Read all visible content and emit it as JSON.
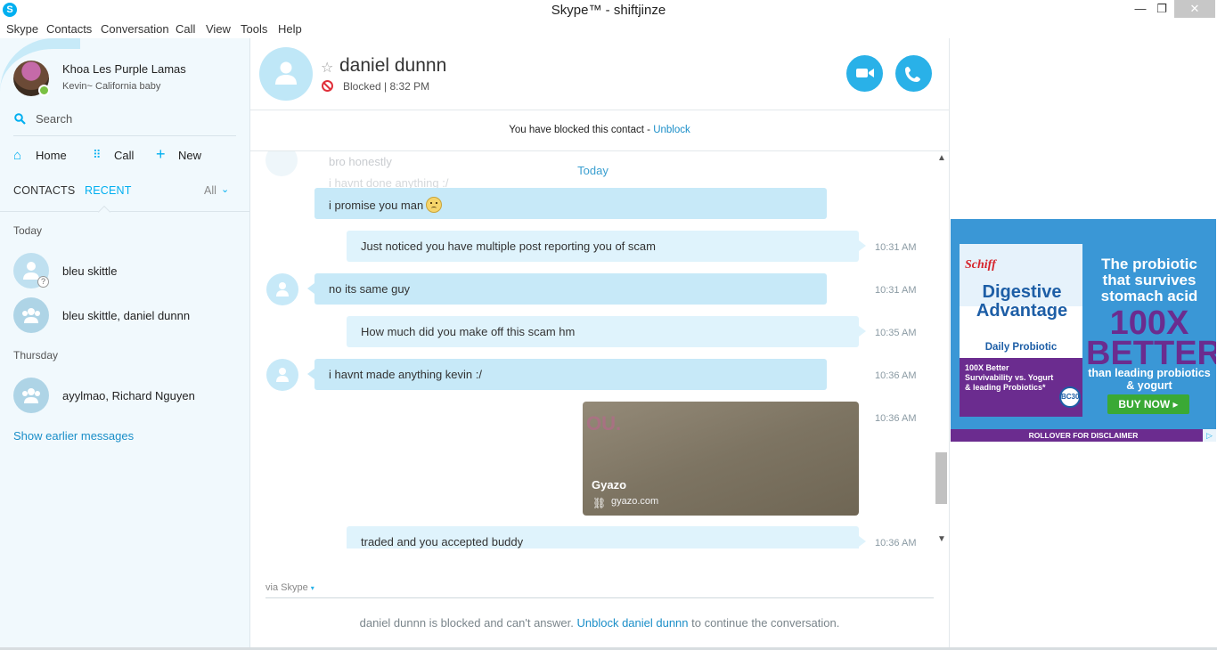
{
  "window": {
    "title": "Skype™ - shiftjinze",
    "logo_glyph": "S",
    "min_glyph": "—",
    "max_glyph": "❐",
    "close_glyph": "✕"
  },
  "menu": [
    "Skype",
    "Contacts",
    "Conversation",
    "Call",
    "View",
    "Tools",
    "Help"
  ],
  "sidebar": {
    "user_name": "Khoa Les Purple Lamas",
    "user_mood": "Kevin~ California baby",
    "search_placeholder": "Search",
    "nav": [
      {
        "label": "Home",
        "icon": "home-icon",
        "glyph": "⌂"
      },
      {
        "label": "Call",
        "icon": "dialpad-icon",
        "glyph": "⠿"
      },
      {
        "label": "New",
        "icon": "plus-icon",
        "glyph": "+"
      }
    ],
    "tabs": {
      "contacts": "CONTACTS",
      "recent": "RECENT",
      "filter": "All",
      "filter_glyph": "⌄"
    },
    "groups": [
      {
        "label": "Today",
        "items": [
          "bleu skittle",
          "bleu skittle, daniel dunnn"
        ]
      },
      {
        "label": "Thursday",
        "items": [
          "ayylmao, Richard Nguyen"
        ]
      }
    ],
    "unknown_badge": "?",
    "show_earlier": "Show earlier messages"
  },
  "chat": {
    "contact_name": "daniel dunnn",
    "star_glyph": "☆",
    "status": "Blocked | 8:32 PM",
    "blocked_banner": {
      "text": "You have blocked this contact - ",
      "link": "Unblock"
    },
    "today_separator": "Today",
    "ghost_messages": [
      "bro honestly",
      "i havnt done anything :/"
    ],
    "messages": [
      {
        "direction": "in",
        "text": "i promise you man",
        "time": ""
      },
      {
        "direction": "out",
        "text": "Just noticed you have multiple post reporting you of scam",
        "time": "10:31 AM"
      },
      {
        "direction": "in",
        "text": "no its same guy",
        "time": "10:31 AM"
      },
      {
        "direction": "out",
        "text": "How much did you make off this scam hm",
        "time": "10:35 AM"
      },
      {
        "direction": "in",
        "text": "i havnt made anything kevin :/",
        "time": "10:36 AM"
      },
      {
        "direction": "out",
        "text": "",
        "time": "10:36 AM",
        "card": {
          "title": "Gyazo",
          "domain": "gyazo.com",
          "deco": "OU.",
          "link_glyph": "⛓"
        }
      },
      {
        "direction": "out",
        "text": "traded and you accepted buddy",
        "time": "10:36 AM"
      }
    ],
    "via": "via Skype",
    "via_caret": "▾",
    "blocked_notice": {
      "prefix": "daniel dunnn is blocked and can't answer. ",
      "link": "Unblock daniel dunnn",
      "suffix": " to continue the conversation."
    },
    "scroll_up": "▲",
    "scroll_down": "▼"
  },
  "ad": {
    "brand": "Schiff",
    "product": "Digestive Advantage",
    "daily": "Daily Probiotic",
    "box_text": "100X Better Survivability vs. Yogurt & leading Probiotics*",
    "pc_badge": "BC30",
    "headline": "The probiotic that survives stomach acid",
    "big": "100X BETTER",
    "sub": "than leading probiotics & yogurt",
    "buy": "BUY NOW ▸",
    "disclaimer": "ROLLOVER FOR DISCLAIMER",
    "choices": "▷"
  },
  "colors": {
    "accent": "#00aff0",
    "bubble_in": "#c7e9f8",
    "bubble_out": "#dff3fc",
    "blocked": "#e0303a",
    "link": "#1a8ec8"
  }
}
